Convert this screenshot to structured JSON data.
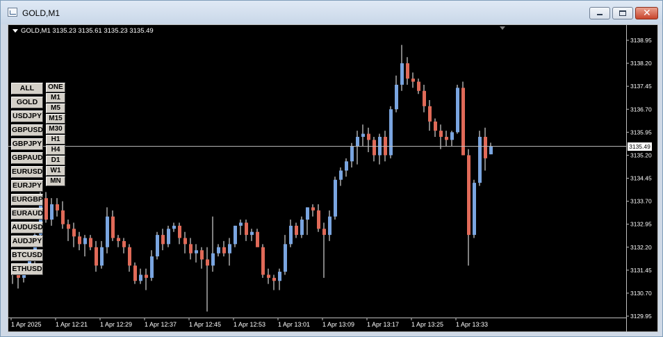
{
  "window": {
    "title": "GOLD,M1",
    "minimize_icon": "minimize-icon",
    "maximize_icon": "maximize-icon",
    "close_icon": "close-icon"
  },
  "chart_header": {
    "info": "GOLD,M1  3135.23 3135.61 3135.23 3135.49"
  },
  "symbol_buttons": [
    "ALL",
    "GOLD",
    "USDJPY",
    "GBPUSD",
    "GBPJPY",
    "GBPAUD",
    "EURUSD",
    "EURJPY",
    "EURGBP",
    "EURAUD",
    "AUDUSD",
    "AUDJPY",
    "BTCUSD",
    "ETHUSD"
  ],
  "timeframe_buttons": [
    "ONE",
    "M1",
    "M5",
    "M15",
    "M30",
    "H1",
    "H4",
    "D1",
    "W1",
    "MN"
  ],
  "colors": {
    "background": "#000000",
    "bull": "#7aa5e0",
    "bear": "#e06a58",
    "wick": "#ffffff",
    "text": "#ffffff",
    "bid_line": "#c0c0c0"
  },
  "chart_data": {
    "type": "candlestick",
    "symbol": "GOLD",
    "timeframe": "M1",
    "ylim": [
      129.9,
      3139.1
    ],
    "y_ticks": [
      "3138.95",
      "3138.20",
      "3137.45",
      "3136.70",
      "3135.95",
      "3135.20",
      "3134.45",
      "3133.70",
      "3132.95",
      "3132.20",
      "3131.45",
      "3130.70",
      "3129.95"
    ],
    "x_ticks": [
      "1 Apr 2025",
      "1 Apr 12:21",
      "1 Apr 12:29",
      "1 Apr 12:37",
      "1 Apr 12:45",
      "1 Apr 12:53",
      "1 Apr 13:01",
      "1 Apr 13:09",
      "1 Apr 13:17",
      "1 Apr 13:25",
      "1 Apr 13:33"
    ],
    "current_price": "3135.49",
    "ohlc": [
      [
        3131.5,
        3131.6,
        3131.05,
        3131.3
      ],
      [
        3131.3,
        3131.4,
        3131.0,
        3131.35
      ],
      [
        3131.35,
        3131.4,
        3130.85,
        3131.2
      ],
      [
        3131.2,
        3131.5,
        3131.05,
        3131.45
      ],
      [
        3131.45,
        3131.9,
        3131.3,
        3131.8
      ],
      [
        3131.8,
        3132.8,
        3131.6,
        3132.6
      ],
      [
        3132.6,
        3134.0,
        3132.3,
        3133.8
      ],
      [
        3133.8,
        3134.0,
        3133.0,
        3133.1
      ],
      [
        3133.1,
        3133.8,
        3132.9,
        3133.6
      ],
      [
        3133.6,
        3133.8,
        3133.2,
        3133.4
      ],
      [
        3133.4,
        3133.7,
        3132.8,
        3132.95
      ],
      [
        3132.95,
        3133.1,
        3132.4,
        3132.8
      ],
      [
        3132.8,
        3133.0,
        3132.2,
        3132.55
      ],
      [
        3132.55,
        3132.7,
        3132.1,
        3132.3
      ],
      [
        3132.3,
        3132.6,
        3131.9,
        3132.5
      ],
      [
        3132.5,
        3132.6,
        3132.1,
        3132.2
      ],
      [
        3132.2,
        3132.4,
        3131.4,
        3131.6
      ],
      [
        3131.6,
        3132.4,
        3131.5,
        3132.2
      ],
      [
        3132.2,
        3133.5,
        3132.0,
        3133.2
      ],
      [
        3133.2,
        3133.4,
        3132.4,
        3132.5
      ],
      [
        3132.5,
        3132.6,
        3132.2,
        3132.4
      ],
      [
        3132.4,
        3132.5,
        3132.0,
        3132.2
      ],
      [
        3132.2,
        3132.3,
        3131.4,
        3131.6
      ],
      [
        3131.6,
        3131.7,
        3131.0,
        3131.1
      ],
      [
        3131.1,
        3131.5,
        3131.0,
        3131.3
      ],
      [
        3131.3,
        3131.5,
        3130.8,
        3131.2
      ],
      [
        3131.2,
        3132.1,
        3131.1,
        3131.9
      ],
      [
        3131.9,
        3132.7,
        3131.8,
        3132.6
      ],
      [
        3132.6,
        3132.8,
        3132.1,
        3132.3
      ],
      [
        3132.3,
        3132.9,
        3132.2,
        3132.8
      ],
      [
        3132.8,
        3133.0,
        3132.7,
        3132.9
      ],
      [
        3132.9,
        3133.0,
        3132.3,
        3132.5
      ],
      [
        3132.5,
        3132.7,
        3132.0,
        3132.3
      ],
      [
        3132.3,
        3132.5,
        3131.8,
        3132.0
      ],
      [
        3132.0,
        3132.3,
        3131.7,
        3132.1
      ],
      [
        3132.1,
        3132.2,
        3131.5,
        3131.8
      ],
      [
        3131.8,
        3132.2,
        3130.1,
        3131.6
      ],
      [
        3131.6,
        3133.2,
        3131.4,
        3132.0
      ],
      [
        3132.0,
        3132.3,
        3131.9,
        3132.2
      ],
      [
        3132.2,
        3132.4,
        3131.9,
        3132.0
      ],
      [
        3132.0,
        3132.5,
        3131.6,
        3132.3
      ],
      [
        3132.3,
        3132.9,
        3132.2,
        3132.9
      ],
      [
        3132.9,
        3133.1,
        3132.6,
        3133.0
      ],
      [
        3133.0,
        3133.1,
        3132.4,
        3132.6
      ],
      [
        3132.6,
        3132.8,
        3132.4,
        3132.7
      ],
      [
        3132.7,
        3132.8,
        3132.3,
        3132.2
      ],
      [
        3132.2,
        3132.3,
        3131.2,
        3131.3
      ],
      [
        3131.3,
        3131.5,
        3131.0,
        3131.2
      ],
      [
        3131.2,
        3131.3,
        3130.8,
        3131.1
      ],
      [
        3131.1,
        3131.5,
        3130.8,
        3131.4
      ],
      [
        3131.4,
        3132.6,
        3131.3,
        3132.3
      ],
      [
        3132.3,
        3133.1,
        3132.2,
        3132.9
      ],
      [
        3132.9,
        3133.0,
        3132.5,
        3132.6
      ],
      [
        3132.6,
        3133.2,
        3132.5,
        3133.1
      ],
      [
        3133.1,
        3133.5,
        3132.6,
        3133.5
      ],
      [
        3133.5,
        3133.6,
        3133.2,
        3133.4
      ],
      [
        3133.4,
        3133.6,
        3132.7,
        3132.8
      ],
      [
        3132.8,
        3133.0,
        3131.2,
        3132.6
      ],
      [
        3132.6,
        3133.4,
        3132.4,
        3133.2
      ],
      [
        3133.2,
        3134.5,
        3133.1,
        3134.4
      ],
      [
        3134.4,
        3134.8,
        3134.2,
        3134.7
      ],
      [
        3134.7,
        3135.1,
        3134.5,
        3135.0
      ],
      [
        3135.0,
        3135.6,
        3134.8,
        3135.5
      ],
      [
        3135.5,
        3136.0,
        3134.9,
        3135.8
      ],
      [
        3135.8,
        3136.2,
        3135.5,
        3135.9
      ],
      [
        3135.9,
        3136.1,
        3135.3,
        3135.7
      ],
      [
        3135.7,
        3135.8,
        3135.0,
        3135.2
      ],
      [
        3135.2,
        3135.9,
        3134.9,
        3135.8
      ],
      [
        3135.8,
        3136.0,
        3135.0,
        3135.2
      ],
      [
        3135.2,
        3136.8,
        3135.1,
        3136.7
      ],
      [
        3136.7,
        3137.8,
        3136.6,
        3137.5
      ],
      [
        3137.5,
        3138.8,
        3137.3,
        3138.2
      ],
      [
        3138.2,
        3138.4,
        3137.5,
        3137.7
      ],
      [
        3137.7,
        3137.9,
        3137.4,
        3137.6
      ],
      [
        3137.6,
        3137.7,
        3137.2,
        3137.3
      ],
      [
        3137.3,
        3137.5,
        3136.6,
        3136.8
      ],
      [
        3136.8,
        3137.0,
        3136.0,
        3136.3
      ],
      [
        3136.3,
        3136.4,
        3135.8,
        3136.0
      ],
      [
        3136.0,
        3136.2,
        3135.4,
        3135.8
      ],
      [
        3135.8,
        3136.0,
        3135.5,
        3135.7
      ],
      [
        3135.7,
        3136.0,
        3135.5,
        3135.95
      ],
      [
        3135.95,
        3137.5,
        3135.9,
        3137.4
      ],
      [
        3137.4,
        3137.6,
        3135.2,
        3135.2
      ],
      [
        3135.2,
        3135.4,
        3131.6,
        3132.6
      ],
      [
        3132.6,
        3134.4,
        3132.5,
        3134.3
      ],
      [
        3134.3,
        3136.0,
        3134.2,
        3135.8
      ],
      [
        3135.8,
        3136.1,
        3134.7,
        3135.1
      ],
      [
        3135.23,
        3135.61,
        3135.23,
        3135.49
      ]
    ]
  }
}
